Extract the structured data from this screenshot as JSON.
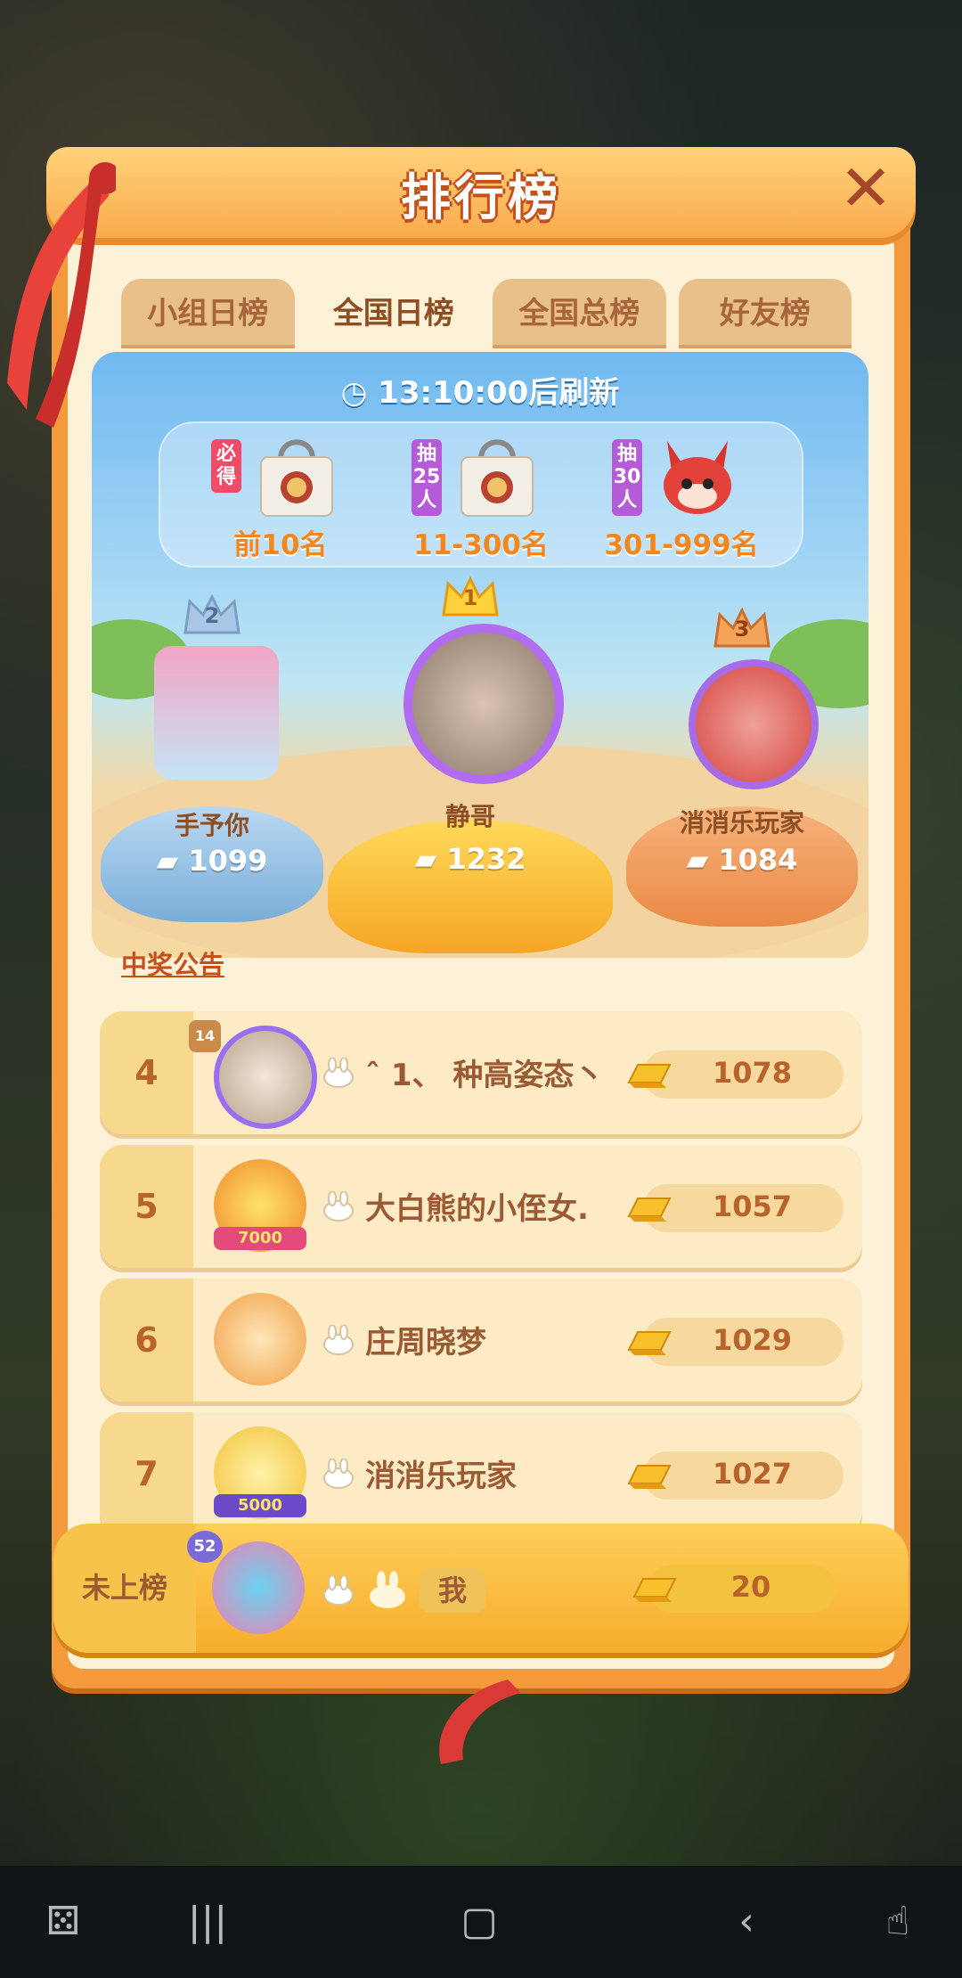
{
  "header": {
    "title": "排行榜"
  },
  "tabs": [
    {
      "label": "小组日榜",
      "active": false
    },
    {
      "label": "全国日榜",
      "active": true
    },
    {
      "label": "全国总榜",
      "active": false
    },
    {
      "label": "好友榜",
      "active": false
    }
  ],
  "refresh": {
    "time": "13:10:00",
    "suffix": "后刷新"
  },
  "rewards": [
    {
      "tag": "必得",
      "label": "前10名"
    },
    {
      "tag": "抽25人",
      "label": "11-300名"
    },
    {
      "tag": "抽30人",
      "label": "301-999名"
    }
  ],
  "podium": {
    "first": {
      "rank": "1",
      "name": "静哥",
      "score": "1232"
    },
    "second": {
      "rank": "2",
      "name": "手予你",
      "score": "1099"
    },
    "third": {
      "rank": "3",
      "name": "消消乐玩家",
      "score": "1084"
    }
  },
  "announce": "中奖公告",
  "rows": [
    {
      "rank": "4",
      "badge": "14",
      "name": "ˆ 1、 种高姿态丶",
      "score": "1078"
    },
    {
      "rank": "5",
      "badge": "7000",
      "name": "大白熊的小侄女.",
      "score": "1057"
    },
    {
      "rank": "6",
      "name": "庄周晓梦",
      "score": "1029"
    },
    {
      "rank": "7",
      "badge": "5000",
      "name": "消消乐玩家",
      "score": "1027"
    }
  ],
  "me": {
    "rank": "未上榜",
    "badge": "52",
    "name": "我",
    "score": "20"
  },
  "colors": {
    "accent": "#f39a3d",
    "gold": "#f6b431",
    "brown": "#9b5a34"
  }
}
